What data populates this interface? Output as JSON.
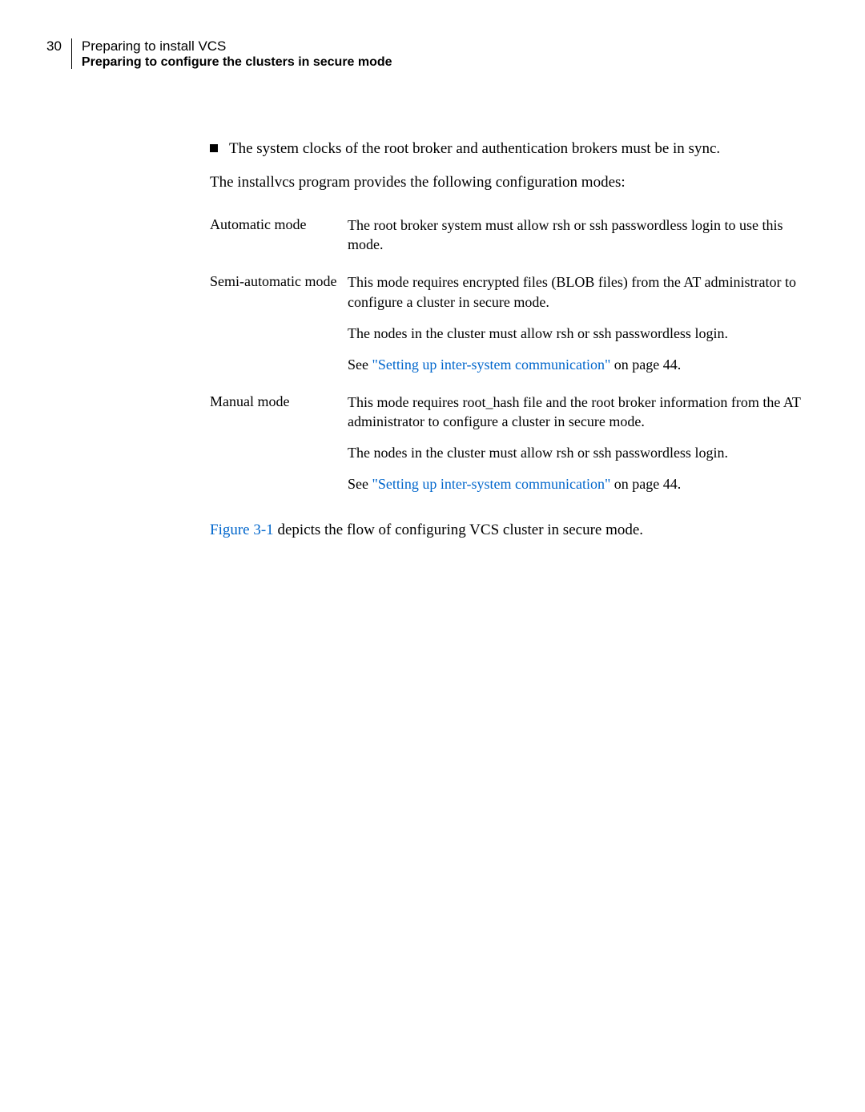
{
  "header": {
    "page_number": "30",
    "title_line1": "Preparing to install VCS",
    "title_line2": "Preparing to configure the clusters in secure mode"
  },
  "bullet": {
    "text": "The system clocks of the root broker and authentication brokers must be in sync."
  },
  "intro": "The installvcs program provides the following configuration modes:",
  "modes": [
    {
      "label": "Automatic mode",
      "paragraphs": [
        {
          "text": "The root broker system must allow rsh or ssh passwordless login to use this mode."
        }
      ]
    },
    {
      "label": "Semi-automatic mode",
      "paragraphs": [
        {
          "text": "This mode requires encrypted files (BLOB files) from the AT administrator to configure a cluster in secure mode."
        },
        {
          "text": "The nodes in the cluster must allow rsh or ssh passwordless login."
        },
        {
          "prefix": "See ",
          "link": "\"Setting up inter-system communication\"",
          "suffix": " on page 44."
        }
      ]
    },
    {
      "label": "Manual mode",
      "paragraphs": [
        {
          "text": "This mode requires root_hash file and the root broker information from the AT administrator to configure a cluster in secure mode."
        },
        {
          "text": "The nodes in the cluster must allow rsh or ssh passwordless login."
        },
        {
          "prefix": "See ",
          "link": "\"Setting up inter-system communication\"",
          "suffix": " on page 44."
        }
      ]
    }
  ],
  "footer": {
    "link": "Figure 3-1",
    "suffix": " depicts the flow of configuring VCS cluster in secure mode."
  }
}
